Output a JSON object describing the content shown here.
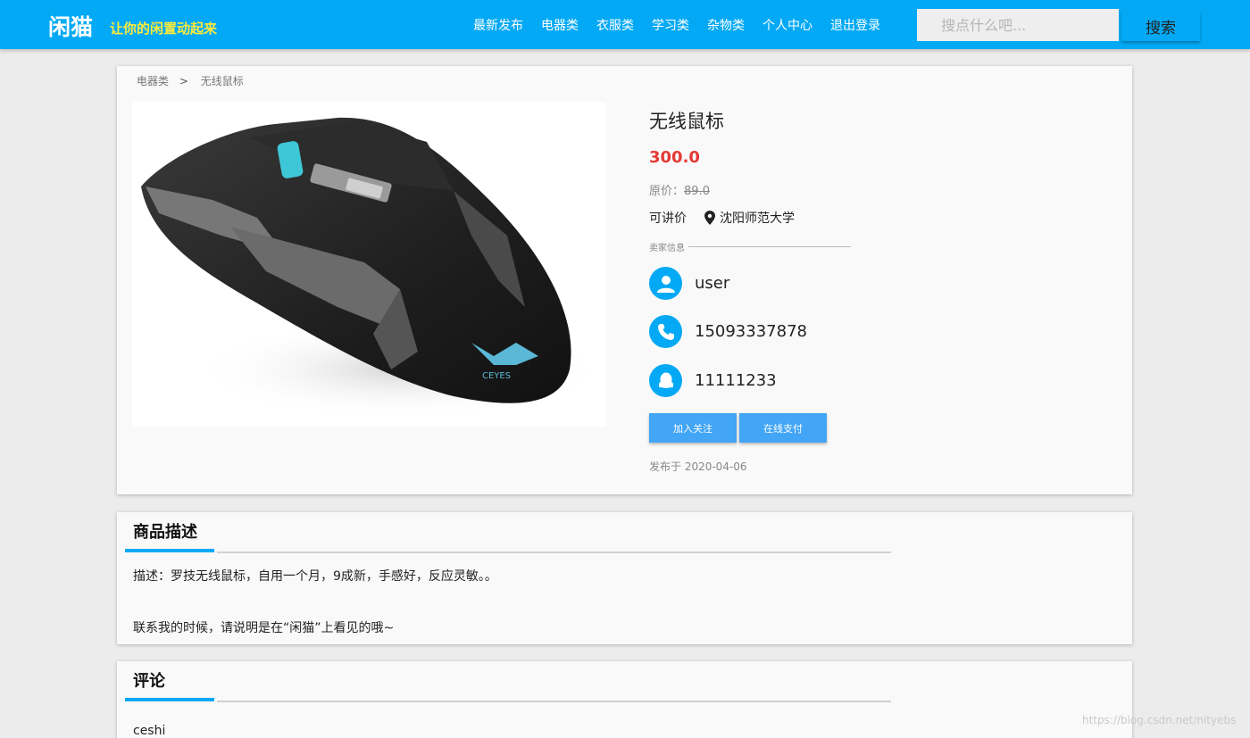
{
  "header": {
    "logo": "闲猫",
    "slogan": "让你的闲置动起来",
    "nav": [
      "最新发布",
      "电器类",
      "衣服类",
      "学习类",
      "杂物类",
      "个人中心",
      "退出登录"
    ],
    "search_placeholder": "搜点什么吧...",
    "search_button": "搜索"
  },
  "breadcrumb": {
    "category": "电器类",
    "separator": ">",
    "item": "无线鼠标"
  },
  "product": {
    "title": "无线鼠标",
    "price": "300.0",
    "original_price_label": "原价：",
    "original_price": "89.0",
    "negotiable": "可讲价",
    "location": "沈阳师范大学",
    "seller_info_label": "卖家信息",
    "seller_name": "user",
    "phone": "15093337878",
    "qq": "11111233",
    "follow_button": "加入关注",
    "pay_button": "在线支付",
    "published": "发布于 2020-04-06",
    "image_brand_text": "CEYES"
  },
  "description": {
    "title": "商品描述",
    "line1": "描述：罗技无线鼠标，自用一个月，9成新，手感好，反应灵敏。。",
    "line2": "联系我的时候，请说明是在“闲猫”上看见的哦~"
  },
  "comments": {
    "title": "评论",
    "items": [
      "ceshi"
    ]
  },
  "watermark": "https://blog.csdn.net/nityebs",
  "colors": {
    "primary": "#03a9f4",
    "price": "#e53935",
    "slogan": "#ffeb3b",
    "button": "#42a5f5"
  }
}
